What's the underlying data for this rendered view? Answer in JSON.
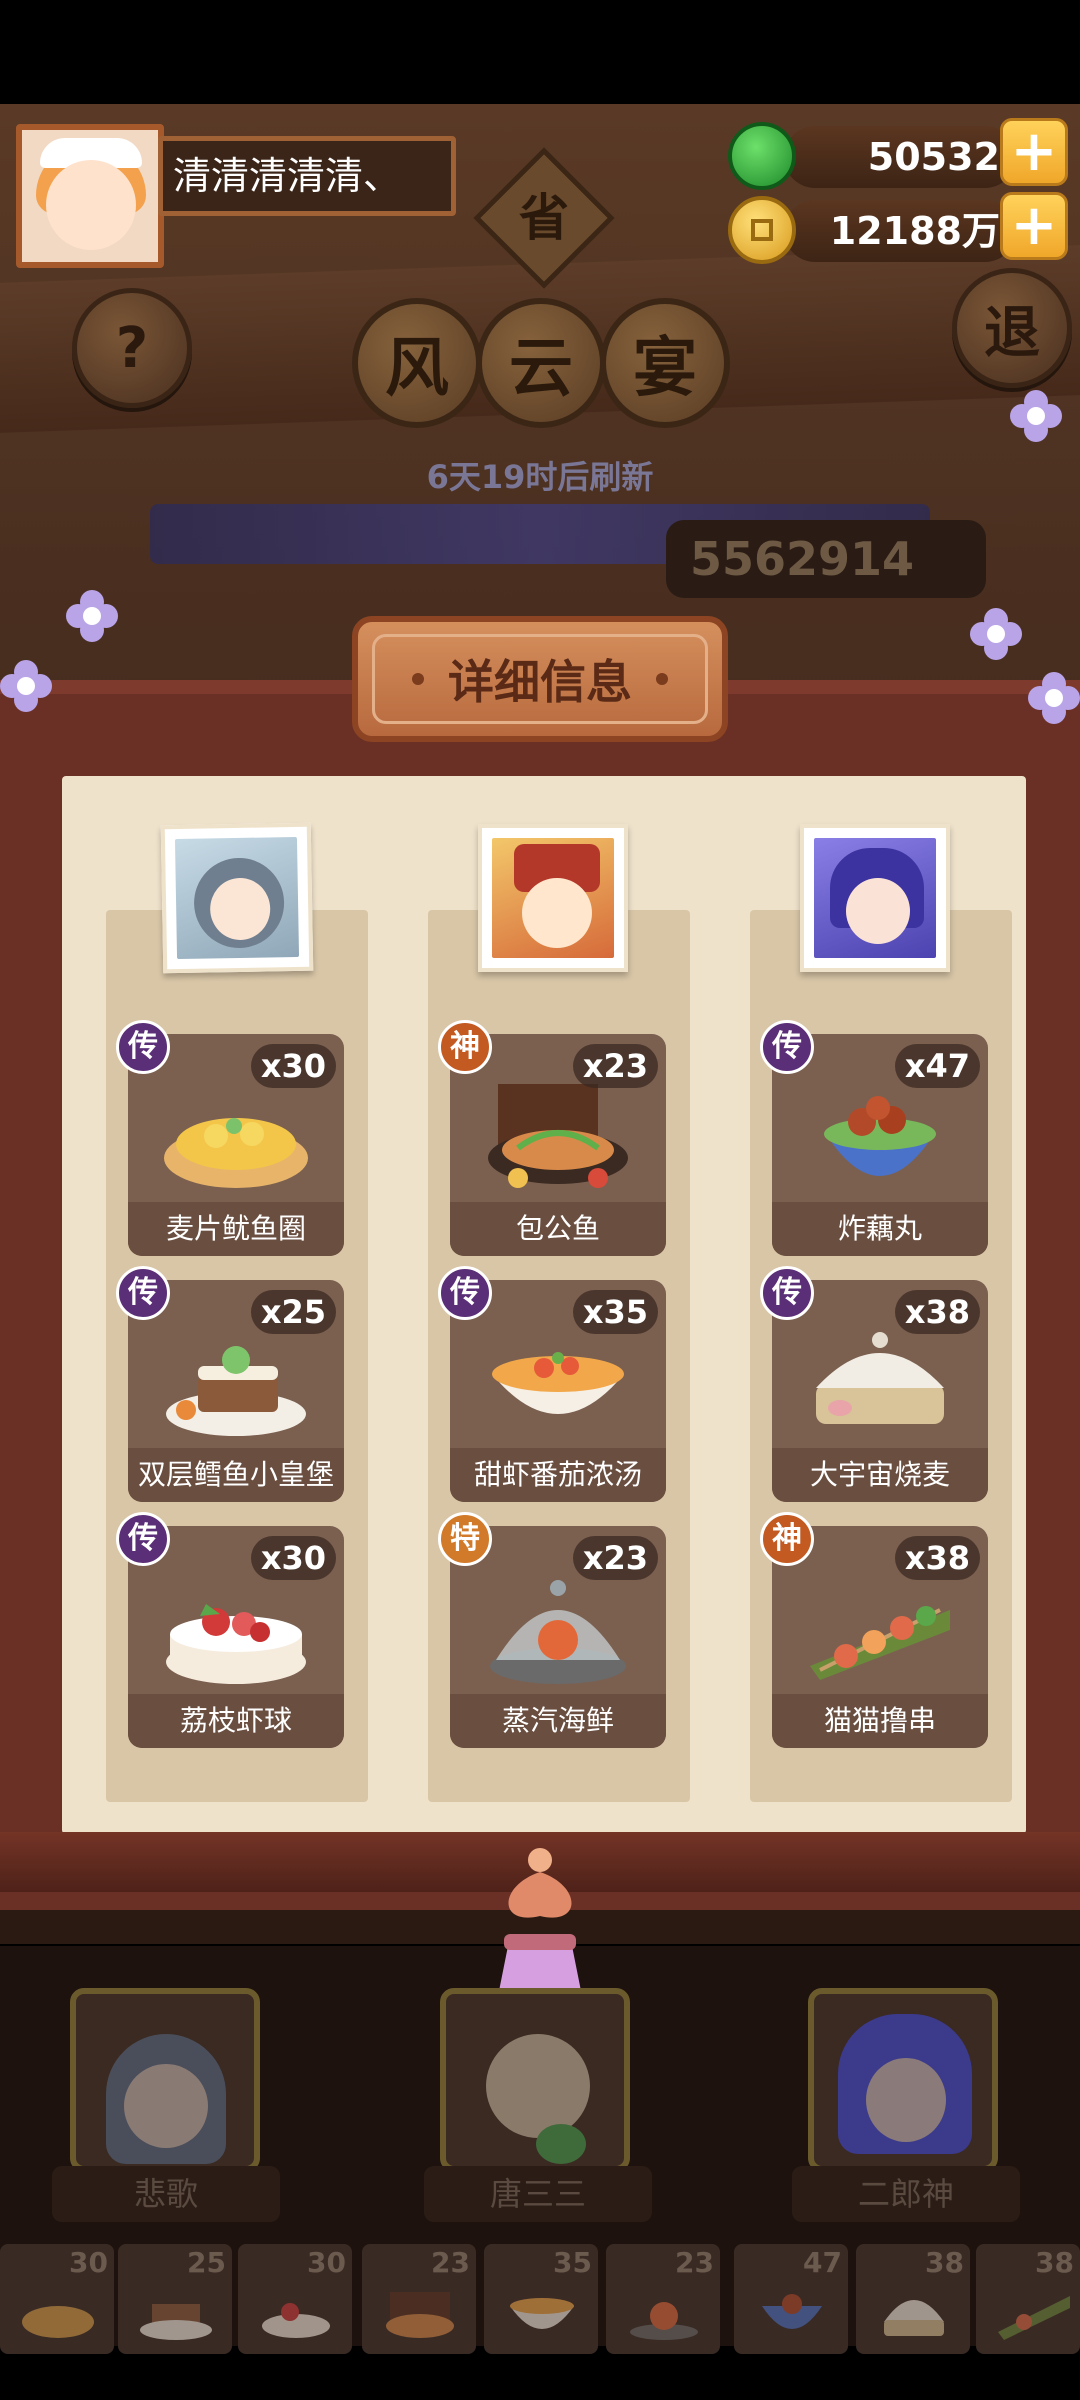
{
  "header": {
    "player_name": "清清清清清、",
    "currency": [
      {
        "name": "jade",
        "value": "50532"
      },
      {
        "name": "coins",
        "value": "12188万"
      }
    ],
    "plus_label": "+",
    "help_label": "?",
    "exit_label": "退",
    "province_label": "省"
  },
  "event": {
    "title_chars": [
      "风",
      "云",
      "宴"
    ],
    "refresh_text": "6天19时后刷新",
    "score": "5562914"
  },
  "modal": {
    "title": "详细信息",
    "columns": [
      {
        "portrait": "gray-hair-scholar",
        "dishes": [
          {
            "name": "麦片鱿鱼圈",
            "count": "x30",
            "badge": "传"
          },
          {
            "name": "双层鳕鱼小皇堡",
            "count": "x25",
            "badge": "传"
          },
          {
            "name": "荔枝虾球",
            "count": "x30",
            "badge": "传"
          }
        ]
      },
      {
        "portrait": "judge-bao",
        "dishes": [
          {
            "name": "包公鱼",
            "count": "x23",
            "badge": "神"
          },
          {
            "name": "甜虾番茄浓汤",
            "count": "x35",
            "badge": "传"
          },
          {
            "name": "蒸汽海鲜",
            "count": "x23",
            "badge": "特"
          }
        ]
      },
      {
        "portrait": "erlang-shen",
        "dishes": [
          {
            "name": "炸藕丸",
            "count": "x47",
            "badge": "传"
          },
          {
            "name": "大宇宙烧麦",
            "count": "x38",
            "badge": "传"
          },
          {
            "name": "猫猫撸串",
            "count": "x38",
            "badge": "神"
          }
        ]
      }
    ]
  },
  "heroes": [
    {
      "name": "悲歌"
    },
    {
      "name": "唐三三"
    },
    {
      "name": "二郎神"
    }
  ],
  "bottom_tray": [
    "30",
    "25",
    "30",
    "23",
    "35",
    "23",
    "47",
    "38",
    "38"
  ],
  "colors": {
    "badge_chuan": "#5b2f77",
    "badge_shen": "#c25a22",
    "badge_te": "#d07a2a",
    "plus_button": "#ffd25a"
  }
}
